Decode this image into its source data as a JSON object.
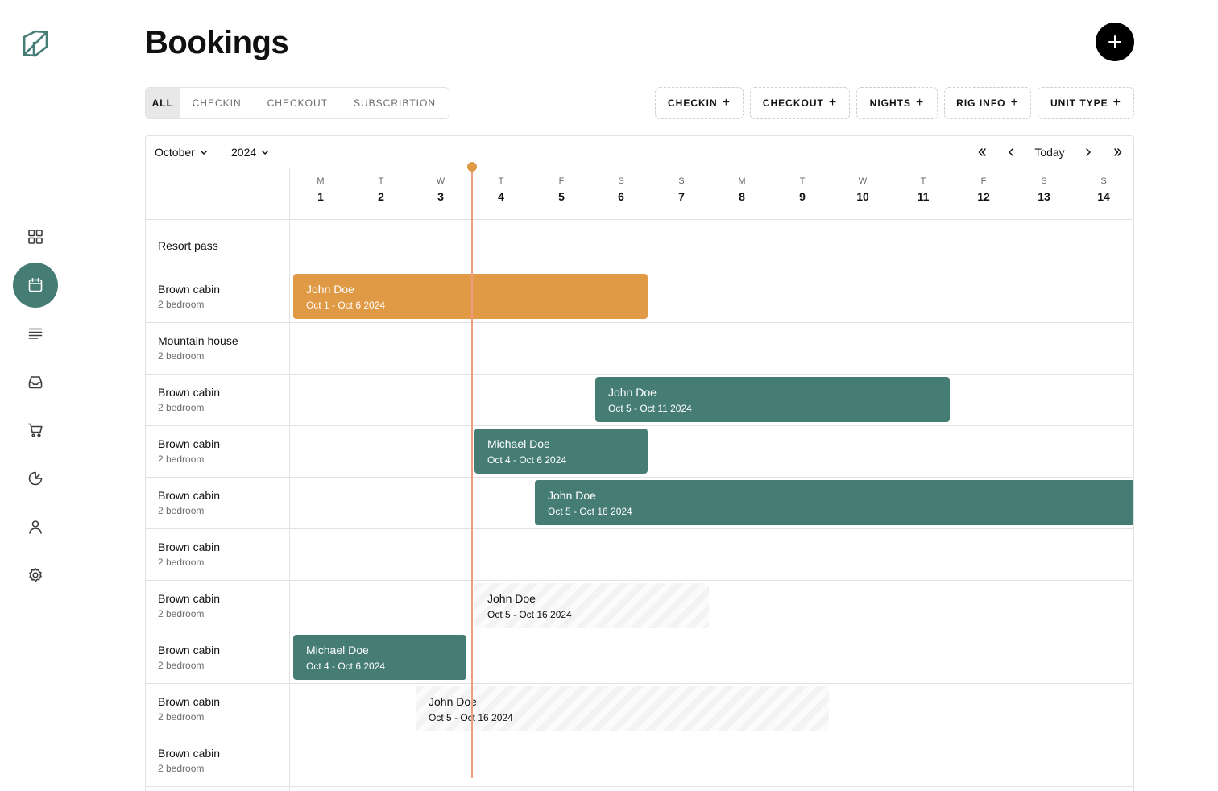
{
  "app": {
    "brand_icon": "leaf-logo-icon",
    "accent": "#457d75",
    "booking_orange": "#e09a46",
    "today_marker": "#ef9c83"
  },
  "sidebar": {
    "items": [
      {
        "icon": "dashboard-grid-icon"
      },
      {
        "icon": "calendar-icon",
        "active": true
      },
      {
        "icon": "list-lines-icon"
      },
      {
        "icon": "inbox-icon"
      },
      {
        "icon": "shopping-cart-icon"
      },
      {
        "icon": "pie-chart-icon"
      },
      {
        "icon": "user-icon"
      },
      {
        "icon": "settings-gear-icon"
      }
    ]
  },
  "header": {
    "title": "Bookings",
    "add_icon": "plus-icon"
  },
  "tabs": [
    {
      "label": "ALL",
      "active": true
    },
    {
      "label": "CHECKIN"
    },
    {
      "label": "CHECKOUT"
    },
    {
      "label": "SUBSCRIBTION"
    }
  ],
  "filters": [
    {
      "label": "CHECKIN",
      "plus": "+"
    },
    {
      "label": "CHECKOUT",
      "plus": "+"
    },
    {
      "label": "NIGHTS",
      "plus": "+"
    },
    {
      "label": "RIG INFO",
      "plus": "+"
    },
    {
      "label": "UNIT TYPE",
      "plus": "+"
    }
  ],
  "calendar": {
    "month": "October",
    "year": "2024",
    "first_page_glyph": "«",
    "prev_glyph": "‹",
    "today_label": "Today",
    "next_glyph": "›",
    "last_page_glyph": "»",
    "days": [
      {
        "dow": "M",
        "num": "1"
      },
      {
        "dow": "T",
        "num": "2"
      },
      {
        "dow": "W",
        "num": "3"
      },
      {
        "dow": "T",
        "num": "4"
      },
      {
        "dow": "F",
        "num": "5"
      },
      {
        "dow": "S",
        "num": "6"
      },
      {
        "dow": "S",
        "num": "7"
      },
      {
        "dow": "M",
        "num": "8"
      },
      {
        "dow": "T",
        "num": "9"
      },
      {
        "dow": "W",
        "num": "10"
      },
      {
        "dow": "T",
        "num": "11"
      },
      {
        "dow": "F",
        "num": "12"
      },
      {
        "dow": "S",
        "num": "13"
      },
      {
        "dow": "S",
        "num": "14"
      }
    ],
    "rows": [
      {
        "name": "Resort pass",
        "sub": ""
      },
      {
        "name": "Brown cabin",
        "sub": "2 bedroom"
      },
      {
        "name": "Mountain house",
        "sub": "2 bedroom"
      },
      {
        "name": "Brown cabin",
        "sub": "2 bedroom"
      },
      {
        "name": "Brown cabin",
        "sub": "2 bedroom"
      },
      {
        "name": "Brown cabin",
        "sub": "2 bedroom"
      },
      {
        "name": "Brown cabin",
        "sub": "2 bedroom"
      },
      {
        "name": "Brown cabin",
        "sub": "2 bedroom"
      },
      {
        "name": "Brown cabin",
        "sub": "2 bedroom"
      },
      {
        "name": "Brown cabin",
        "sub": "2 bedroom"
      },
      {
        "name": "Brown cabin",
        "sub": "2 bedroom"
      }
    ],
    "bookings": [
      {
        "guest": "John Doe",
        "dates": "Oct 1 - Oct 6 2024",
        "style": "orange"
      },
      {
        "guest": "John Doe",
        "dates": "Oct 5 - Oct 11 2024",
        "style": "teal"
      },
      {
        "guest": "Michael Doe",
        "dates": "Oct 4 - Oct 6 2024",
        "style": "teal"
      },
      {
        "guest": "John Doe",
        "dates": "Oct 5 - Oct 16 2024",
        "style": "teal"
      },
      {
        "guest": "John Doe",
        "dates": "Oct 5 - Oct 16 2024",
        "style": "striped"
      },
      {
        "guest": "Michael Doe",
        "dates": "Oct 4 - Oct 6 2024",
        "style": "teal"
      },
      {
        "guest": "John Doe",
        "dates": "Oct 5 - Oct 16 2024",
        "style": "striped"
      }
    ]
  }
}
